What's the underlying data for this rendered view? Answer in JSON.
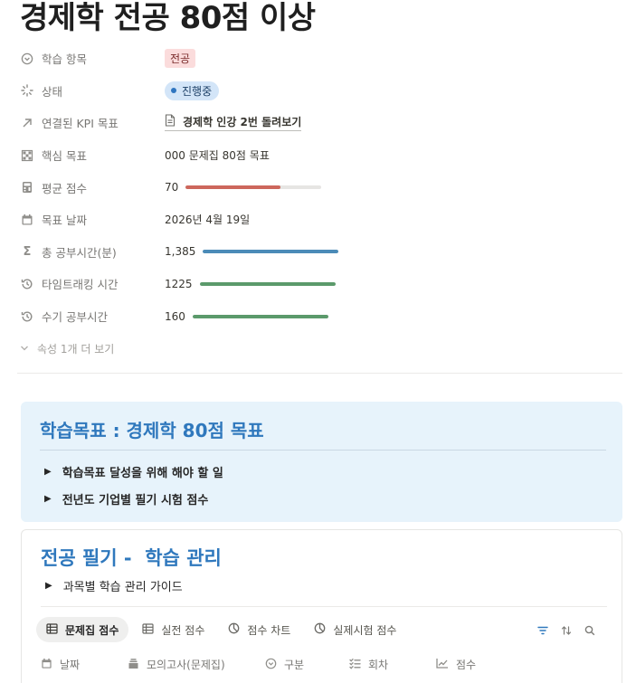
{
  "page": {
    "title": "경제학 전공 80점 이상"
  },
  "properties": {
    "study_item": {
      "label": "학습 항목",
      "value": "전공"
    },
    "status": {
      "label": "상태",
      "value": "진행중"
    },
    "kpi": {
      "label": "연결된 KPI 목표",
      "value": "경제학 인강 2번 돌려보기"
    },
    "core_goal": {
      "label": "핵심 목표",
      "value": "000 문제집 80점 목표"
    },
    "avg_score": {
      "label": "평균 점수",
      "value": "70",
      "progress": 0.7,
      "color": "#cd675c"
    },
    "target_date": {
      "label": "목표 날짜",
      "value": "2026년 4월 19일"
    },
    "total_time": {
      "label": "총 공부시간(분)",
      "value": "1,385",
      "progress": 1.0,
      "color": "#4b8bb8"
    },
    "time_tracking": {
      "label": "타임트래킹 시간",
      "value": "1225",
      "progress": 1.0,
      "color": "#5b9a6b"
    },
    "manual_time": {
      "label": "수기 공부시간",
      "value": "160",
      "progress": 1.0,
      "color": "#5b9a6b"
    },
    "more_label": "속성 1개 더 보기"
  },
  "callout": {
    "title": "학습목표 : 경제학 80점 목표",
    "toggles": [
      "학습목표 달성을 위해 해야 할 일",
      "전년도 기업별 필기 시험 점수"
    ]
  },
  "section": {
    "title": "전공 필기 -  학습 관리",
    "toggle": "과목별 학습 관리  가이드",
    "tabs": [
      {
        "label": "문제집 점수",
        "icon": "table-icon",
        "active": true
      },
      {
        "label": "실전 점수",
        "icon": "table-icon",
        "active": false
      },
      {
        "label": "점수 차트",
        "icon": "pie-chart-icon",
        "active": false
      },
      {
        "label": "실제시험 점수",
        "icon": "pie-chart-icon",
        "active": false
      }
    ],
    "columns": [
      {
        "label": "날짜",
        "icon": "calendar-icon"
      },
      {
        "label": "모의고사(문제집)",
        "icon": "stack-icon"
      },
      {
        "label": "구분",
        "icon": "select-icon"
      },
      {
        "label": "회차",
        "icon": "checklist-icon"
      },
      {
        "label": "점수",
        "icon": "trend-icon"
      }
    ]
  },
  "colors": {
    "accent_blue": "#2f78bd",
    "callout_bg": "#e7f3fb",
    "tag_red_bg": "#fbdcdc",
    "status_bg": "#d3e5f8"
  }
}
